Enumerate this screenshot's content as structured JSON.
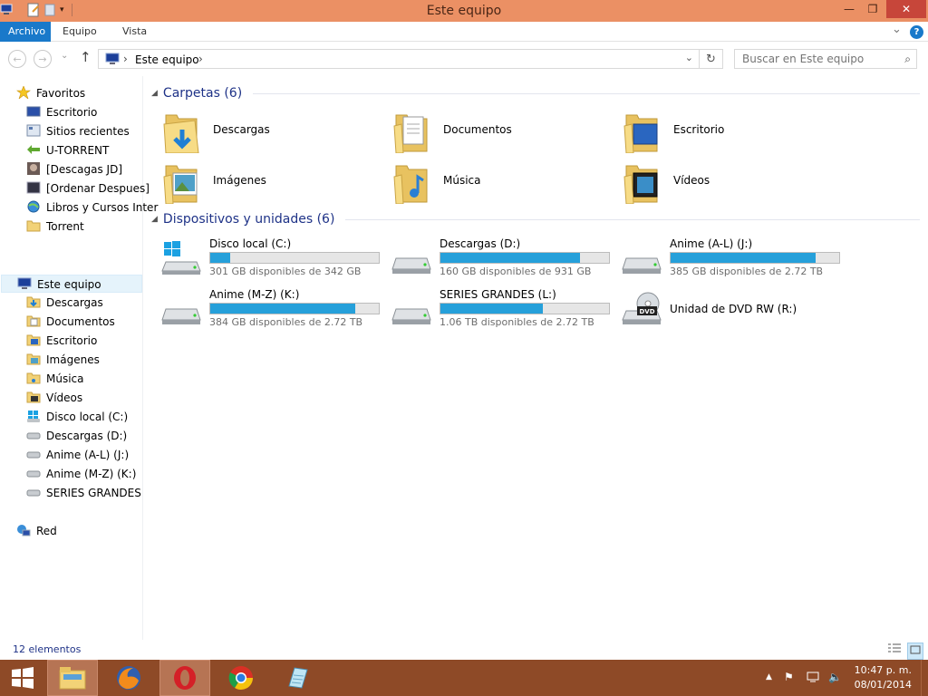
{
  "window": {
    "title": "Este equipo",
    "minimize": "—",
    "restore": "❐",
    "close": "✕"
  },
  "ribbon": {
    "tabs": [
      "Archivo",
      "Equipo",
      "Vista"
    ],
    "expand": "⌄",
    "help": "?"
  },
  "nav": {
    "back": "←",
    "forward": "→",
    "up": "↑",
    "recent": "⌄",
    "address": "Este equipo",
    "address_sep": "›",
    "address_arrow": "⌄",
    "refresh": "↻",
    "search_placeholder": "Buscar en Este equipo",
    "search_icon": "⌕"
  },
  "sidebar": {
    "favorites_label": "Favoritos",
    "favorites": [
      {
        "label": "Escritorio",
        "icon": "desktop-icon"
      },
      {
        "label": "Sitios recientes",
        "icon": "recent-icon"
      },
      {
        "label": "U-TORRENT",
        "icon": "utorrent-icon"
      },
      {
        "label": "[Descagas JD]",
        "icon": "jd-icon"
      },
      {
        "label": "[Ordenar Despues]",
        "icon": "folder-icon"
      },
      {
        "label": "Libros y Cursos Inter",
        "icon": "globe-icon"
      },
      {
        "label": "Torrent",
        "icon": "folder-icon"
      }
    ],
    "computer_label": "Este equipo",
    "computer": [
      {
        "label": "Descargas",
        "icon": "downloads-folder-icon"
      },
      {
        "label": "Documentos",
        "icon": "documents-folder-icon"
      },
      {
        "label": "Escritorio",
        "icon": "desktop-folder-icon"
      },
      {
        "label": "Imágenes",
        "icon": "pictures-folder-icon"
      },
      {
        "label": "Música",
        "icon": "music-folder-icon"
      },
      {
        "label": "Vídeos",
        "icon": "videos-folder-icon"
      },
      {
        "label": "Disco local (C:)",
        "icon": "windows-drive-icon"
      },
      {
        "label": "Descargas (D:)",
        "icon": "drive-icon"
      },
      {
        "label": "Anime (A-L) (J:)",
        "icon": "drive-icon"
      },
      {
        "label": "Anime (M-Z) (K:)",
        "icon": "drive-icon"
      },
      {
        "label": "SERIES GRANDES (L:)",
        "icon": "drive-icon"
      }
    ],
    "network_label": "Red"
  },
  "folders": {
    "title": "Carpetas (6)",
    "items": [
      {
        "name": "Descargas",
        "icon": "downloads-folder-icon"
      },
      {
        "name": "Documentos",
        "icon": "documents-folder-icon"
      },
      {
        "name": "Escritorio",
        "icon": "desktop-folder-icon"
      },
      {
        "name": "Imágenes",
        "icon": "pictures-folder-icon"
      },
      {
        "name": "Música",
        "icon": "music-folder-icon"
      },
      {
        "name": "Vídeos",
        "icon": "videos-folder-icon"
      }
    ]
  },
  "devices": {
    "title": "Dispositivos y unidades (6)",
    "items": [
      {
        "name": "Disco local (C:)",
        "free": "301 GB disponibles de 342 GB",
        "used_fraction": 0.12,
        "icon": "windows-drive-icon"
      },
      {
        "name": "Descargas (D:)",
        "free": "160 GB disponibles de 931 GB",
        "used_fraction": 0.83,
        "icon": "drive-icon"
      },
      {
        "name": "Anime (A-L) (J:)",
        "free": "385 GB disponibles de 2.72 TB",
        "used_fraction": 0.86,
        "icon": "drive-icon"
      },
      {
        "name": "Anime (M-Z) (K:)",
        "free": "384 GB disponibles de 2.72 TB",
        "used_fraction": 0.86,
        "icon": "drive-icon"
      },
      {
        "name": "SERIES GRANDES (L:)",
        "free": "1.06 TB disponibles de 2.72 TB",
        "used_fraction": 0.61,
        "icon": "drive-icon"
      },
      {
        "name": "Unidad de DVD RW (R:)",
        "icon": "dvd-drive-icon",
        "badge": "DVD"
      }
    ]
  },
  "status": {
    "count": "12 elementos"
  },
  "taskbar": {
    "time": "10:47 p. m.",
    "date": "08/01/2014",
    "tray_arrow": "▲",
    "flag": "⚑",
    "volume": "🔈"
  },
  "colors": {
    "titlebar": "#eb9064",
    "ribbon_active": "#1979ca",
    "taskbar": "#8e4a27",
    "bar_fill": "#26a0da",
    "section_title": "#1e3287"
  }
}
